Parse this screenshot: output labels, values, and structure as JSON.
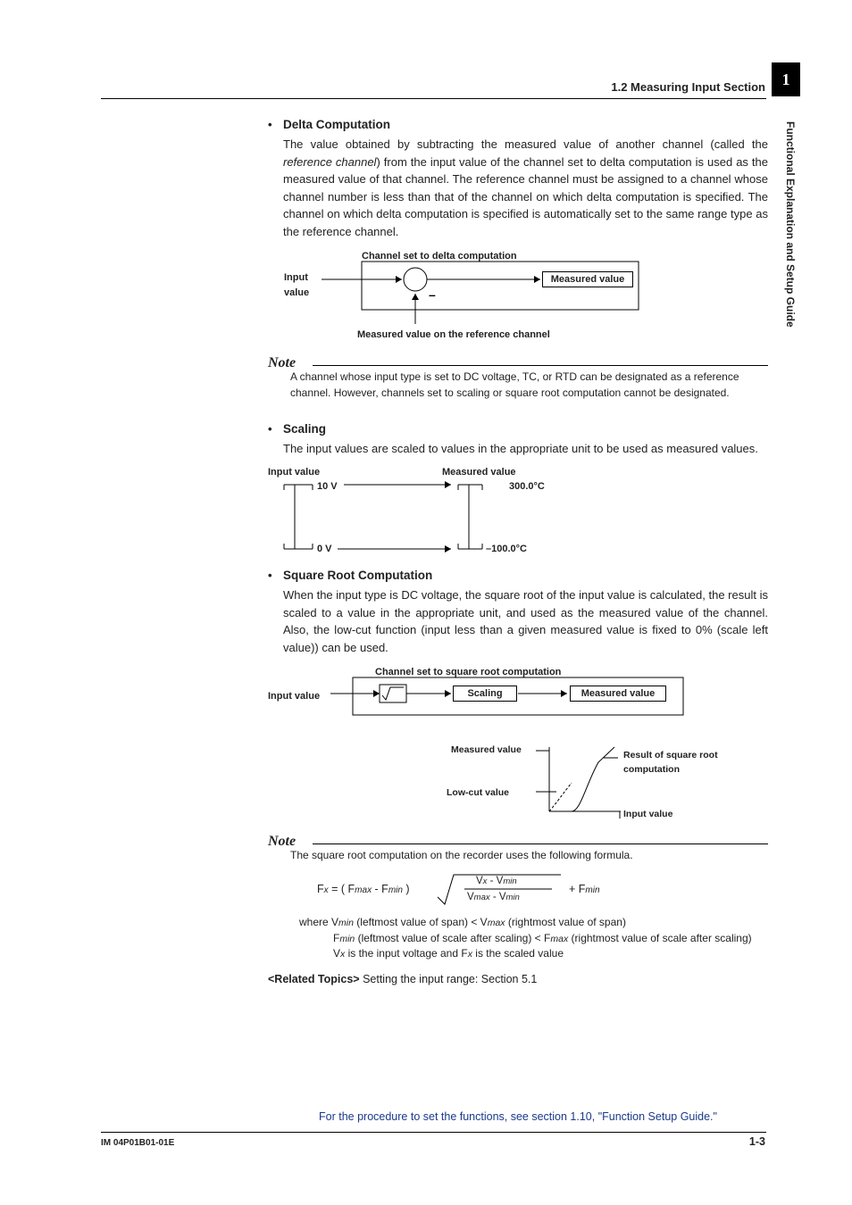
{
  "header": {
    "section": "1.2  Measuring Input Section",
    "tab": "1",
    "side": "Functional Explanation and Setup Guide"
  },
  "delta": {
    "head": "Delta Computation",
    "body_pre": "The value obtained by subtracting the measured value of another channel (called the ",
    "body_ital": "reference channel",
    "body_post": ") from the input value of the channel set to delta computation is used as the measured value of that channel. The reference channel must be assigned to a channel whose channel number is less than that of the channel on which delta computation is specified. The channel on which delta computation is specified is automatically set to the same range type as the reference channel.",
    "fig": {
      "title": "Channel set to delta computation",
      "input": "Input value",
      "measured": "Measured value",
      "minus": "–",
      "refcap": "Measured value on the reference channel"
    },
    "note_head": "Note",
    "note": "A channel whose input type is set to DC voltage, TC, or RTD can be designated as a reference channel. However, channels set to scaling or square root computation cannot be designated."
  },
  "scaling": {
    "head": "Scaling",
    "body": "The input values are scaled to values in the appropriate unit to be used as measured values.",
    "fig": {
      "inLabel": "Input value",
      "outLabel": "Measured value",
      "inHigh": "10 V",
      "inLow": "0 V",
      "outHigh": "300.0°C",
      "outLow": "–100.0°C"
    }
  },
  "sqrt": {
    "head": "Square Root Computation",
    "body": "When the input type is DC voltage, the square root of the input value is calculated, the result is scaled to a value in the appropriate unit, and used as the measured value of the channel. Also, the low-cut function (input less than a given measured value is fixed to 0% (scale left value)) can be used.",
    "fig": {
      "title": "Channel set to square root computation",
      "input": "Input value",
      "scaling": "Scaling",
      "measured": "Measured value",
      "measVal": "Measured value",
      "lowcut": "Low-cut value",
      "result": "Result of square root computation",
      "inputVal": "Input value"
    },
    "note_head": "Note",
    "note_intro": "The square root computation on the recorder uses the following formula.",
    "formula": {
      "Fx": "F",
      "x": "x",
      "eq": " = ( F",
      "max": "max",
      "min": "min",
      "minus": " -  F",
      "paren": " )",
      "Vx": "V",
      "Vmax": "V",
      "Vmin": "V",
      "plus": "  +  F"
    },
    "where1a": "where V",
    "where1b": " (leftmost value of span) < V",
    "where1c": " (rightmost value of span)",
    "where2a": "F",
    "where2b": " (leftmost value of scale after scaling) < F",
    "where2c": " (rightmost value of scale after scaling)",
    "where3a": "V",
    "where3b": " is the input voltage and F",
    "where3c": " is the scaled value"
  },
  "related": {
    "label": "<Related Topics>",
    "text": "  Setting the input range: Section 5.1"
  },
  "footer": {
    "ref": "For the procedure to set the functions, see section 1.10, \"Function Setup Guide.\"",
    "left": "IM 04P01B01-01E",
    "right": "1-3"
  }
}
